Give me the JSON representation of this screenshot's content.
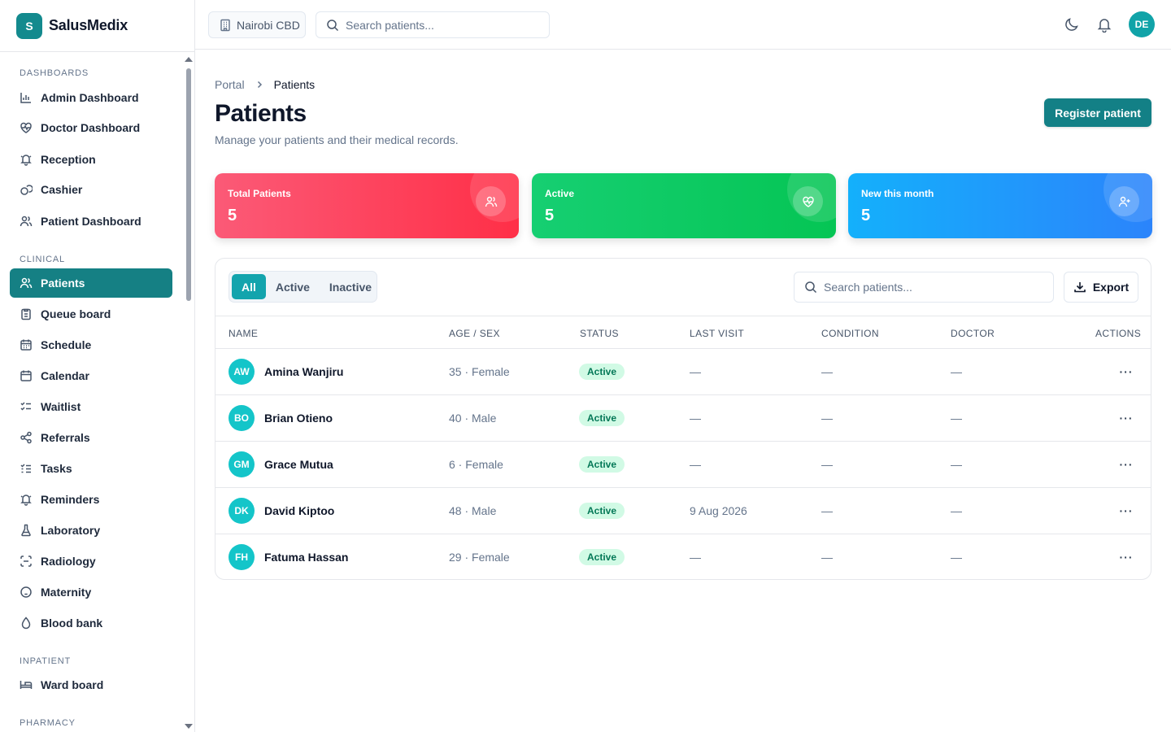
{
  "brand": {
    "logo_letter": "S",
    "name": "SalusMedix"
  },
  "sidebar": {
    "sections": [
      {
        "label": "Dashboards"
      },
      {
        "label": "Clinical"
      },
      {
        "label": "Inpatient"
      },
      {
        "label": "Pharmacy"
      }
    ],
    "items": [
      {
        "label": "Admin Dashboard",
        "icon": "bar-chart-icon"
      },
      {
        "label": "Doctor Dashboard",
        "icon": "heart-pulse-icon"
      },
      {
        "label": "Reception",
        "icon": "bell-ring-icon"
      },
      {
        "label": "Cashier",
        "icon": "coins-icon"
      },
      {
        "label": "Patient Dashboard",
        "icon": "users-icon"
      },
      {
        "label": "Patients",
        "icon": "users-icon",
        "active": true
      },
      {
        "label": "Queue board",
        "icon": "clipboard-list-icon"
      },
      {
        "label": "Schedule",
        "icon": "calendar-days-icon"
      },
      {
        "label": "Calendar",
        "icon": "calendar-icon"
      },
      {
        "label": "Waitlist",
        "icon": "list-checks-icon"
      },
      {
        "label": "Referrals",
        "icon": "share-icon"
      },
      {
        "label": "Tasks",
        "icon": "list-todo-icon"
      },
      {
        "label": "Reminders",
        "icon": "bell-ring-icon"
      },
      {
        "label": "Laboratory",
        "icon": "flask-icon"
      },
      {
        "label": "Radiology",
        "icon": "scan-icon"
      },
      {
        "label": "Maternity",
        "icon": "baby-icon"
      },
      {
        "label": "Blood bank",
        "icon": "droplet-icon"
      },
      {
        "label": "Ward board",
        "icon": "bed-icon"
      }
    ]
  },
  "topbar": {
    "branch": "Nairobi CBD",
    "search_placeholder": "Search patients...",
    "user_initials": "DE"
  },
  "page": {
    "breadcrumb": {
      "parent": "Portal",
      "current": "Patients"
    },
    "title": "Patients",
    "subtitle": "Manage your patients and their medical records.",
    "register_label": "Register patient"
  },
  "stats": [
    {
      "label": "Total Patients",
      "value": "5",
      "icon": "users-icon",
      "color": "#ff3b55"
    },
    {
      "label": "Active",
      "value": "5",
      "icon": "heart-pulse-icon",
      "color": "#08c95c"
    },
    {
      "label": "New this month",
      "value": "5",
      "icon": "user-plus-icon",
      "color": "#1d9bfb"
    }
  ],
  "table": {
    "tabs": [
      {
        "label": "All",
        "active": true
      },
      {
        "label": "Active",
        "active": false
      },
      {
        "label": "Inactive",
        "active": false
      }
    ],
    "search_placeholder": "Search patients...",
    "export_label": "Export",
    "columns": [
      "Name",
      "Age / Sex",
      "Status",
      "Last visit",
      "Condition",
      "Doctor",
      "Actions"
    ],
    "rows": [
      {
        "initials": "AW",
        "name": "Amina Wanjiru",
        "age_sex": "35 · Female",
        "status": "Active",
        "last_visit": "—",
        "condition": "—",
        "doctor": "—",
        "actions": "···"
      },
      {
        "initials": "BO",
        "name": "Brian Otieno",
        "age_sex": "40 · Male",
        "status": "Active",
        "last_visit": "—",
        "condition": "—",
        "doctor": "—",
        "actions": "···"
      },
      {
        "initials": "GM",
        "name": "Grace Mutua",
        "age_sex": "6 · Female",
        "status": "Active",
        "last_visit": "—",
        "condition": "—",
        "doctor": "—",
        "actions": "···"
      },
      {
        "initials": "DK",
        "name": "David Kiptoo",
        "age_sex": "48 · Male",
        "status": "Active",
        "last_visit": "9 Aug 2026",
        "condition": "—",
        "doctor": "—",
        "actions": "···"
      },
      {
        "initials": "FH",
        "name": "Fatuma Hassan",
        "age_sex": "29 · Female",
        "status": "Active",
        "last_visit": "—",
        "condition": "—",
        "doctor": "—",
        "actions": "···"
      }
    ]
  },
  "colors": {
    "primary": "#138086",
    "accent": "#14a4ad",
    "status_active_bg": "#d1fae5",
    "status_active_fg": "#047857"
  }
}
